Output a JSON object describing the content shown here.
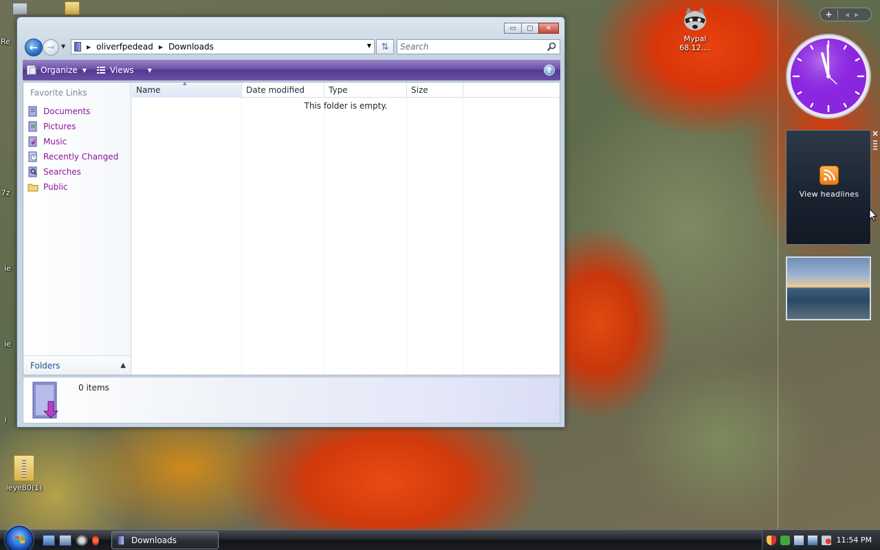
{
  "desktop": {
    "icons": [
      {
        "label": "ieye80(1)"
      }
    ],
    "edge_labels": [
      "Re",
      "7z",
      "ie",
      "ie",
      "i"
    ],
    "mypal": {
      "label": "Mypal",
      "sub": "68.12...."
    }
  },
  "window": {
    "title": "Downloads",
    "caption": {
      "minimize": "▭",
      "maximize": "▢",
      "close": "✕"
    },
    "address": {
      "crumbs": [
        "oliverfpedead",
        "Downloads"
      ]
    },
    "search": {
      "placeholder": "Search"
    },
    "toolbar": {
      "organize": "Organize",
      "views": "Views",
      "help": "?"
    },
    "nav_pane": {
      "title": "Favorite Links",
      "links": [
        {
          "label": "Documents",
          "icon": "documents-icon"
        },
        {
          "label": "Pictures",
          "icon": "pictures-icon"
        },
        {
          "label": "Music",
          "icon": "music-icon"
        },
        {
          "label": "Recently Changed",
          "icon": "recently-changed-icon"
        },
        {
          "label": "Searches",
          "icon": "searches-icon"
        },
        {
          "label": "Public",
          "icon": "public-folder-icon"
        }
      ],
      "folders_label": "Folders"
    },
    "columns": [
      "Name",
      "Date modified",
      "Type",
      "Size"
    ],
    "empty_message": "This folder is empty.",
    "details": {
      "item_count": "0 items"
    }
  },
  "sidebar": {
    "feed_label": "View headlines"
  },
  "taskbar": {
    "active_task": "Downloads",
    "time": "11:54 PM"
  },
  "colors": {
    "toolbar_purple": "#6a4fa7",
    "link_purple": "#8e1396",
    "clock_purple": "#8a25e0",
    "taskbar_dark": "#1b1d21"
  }
}
